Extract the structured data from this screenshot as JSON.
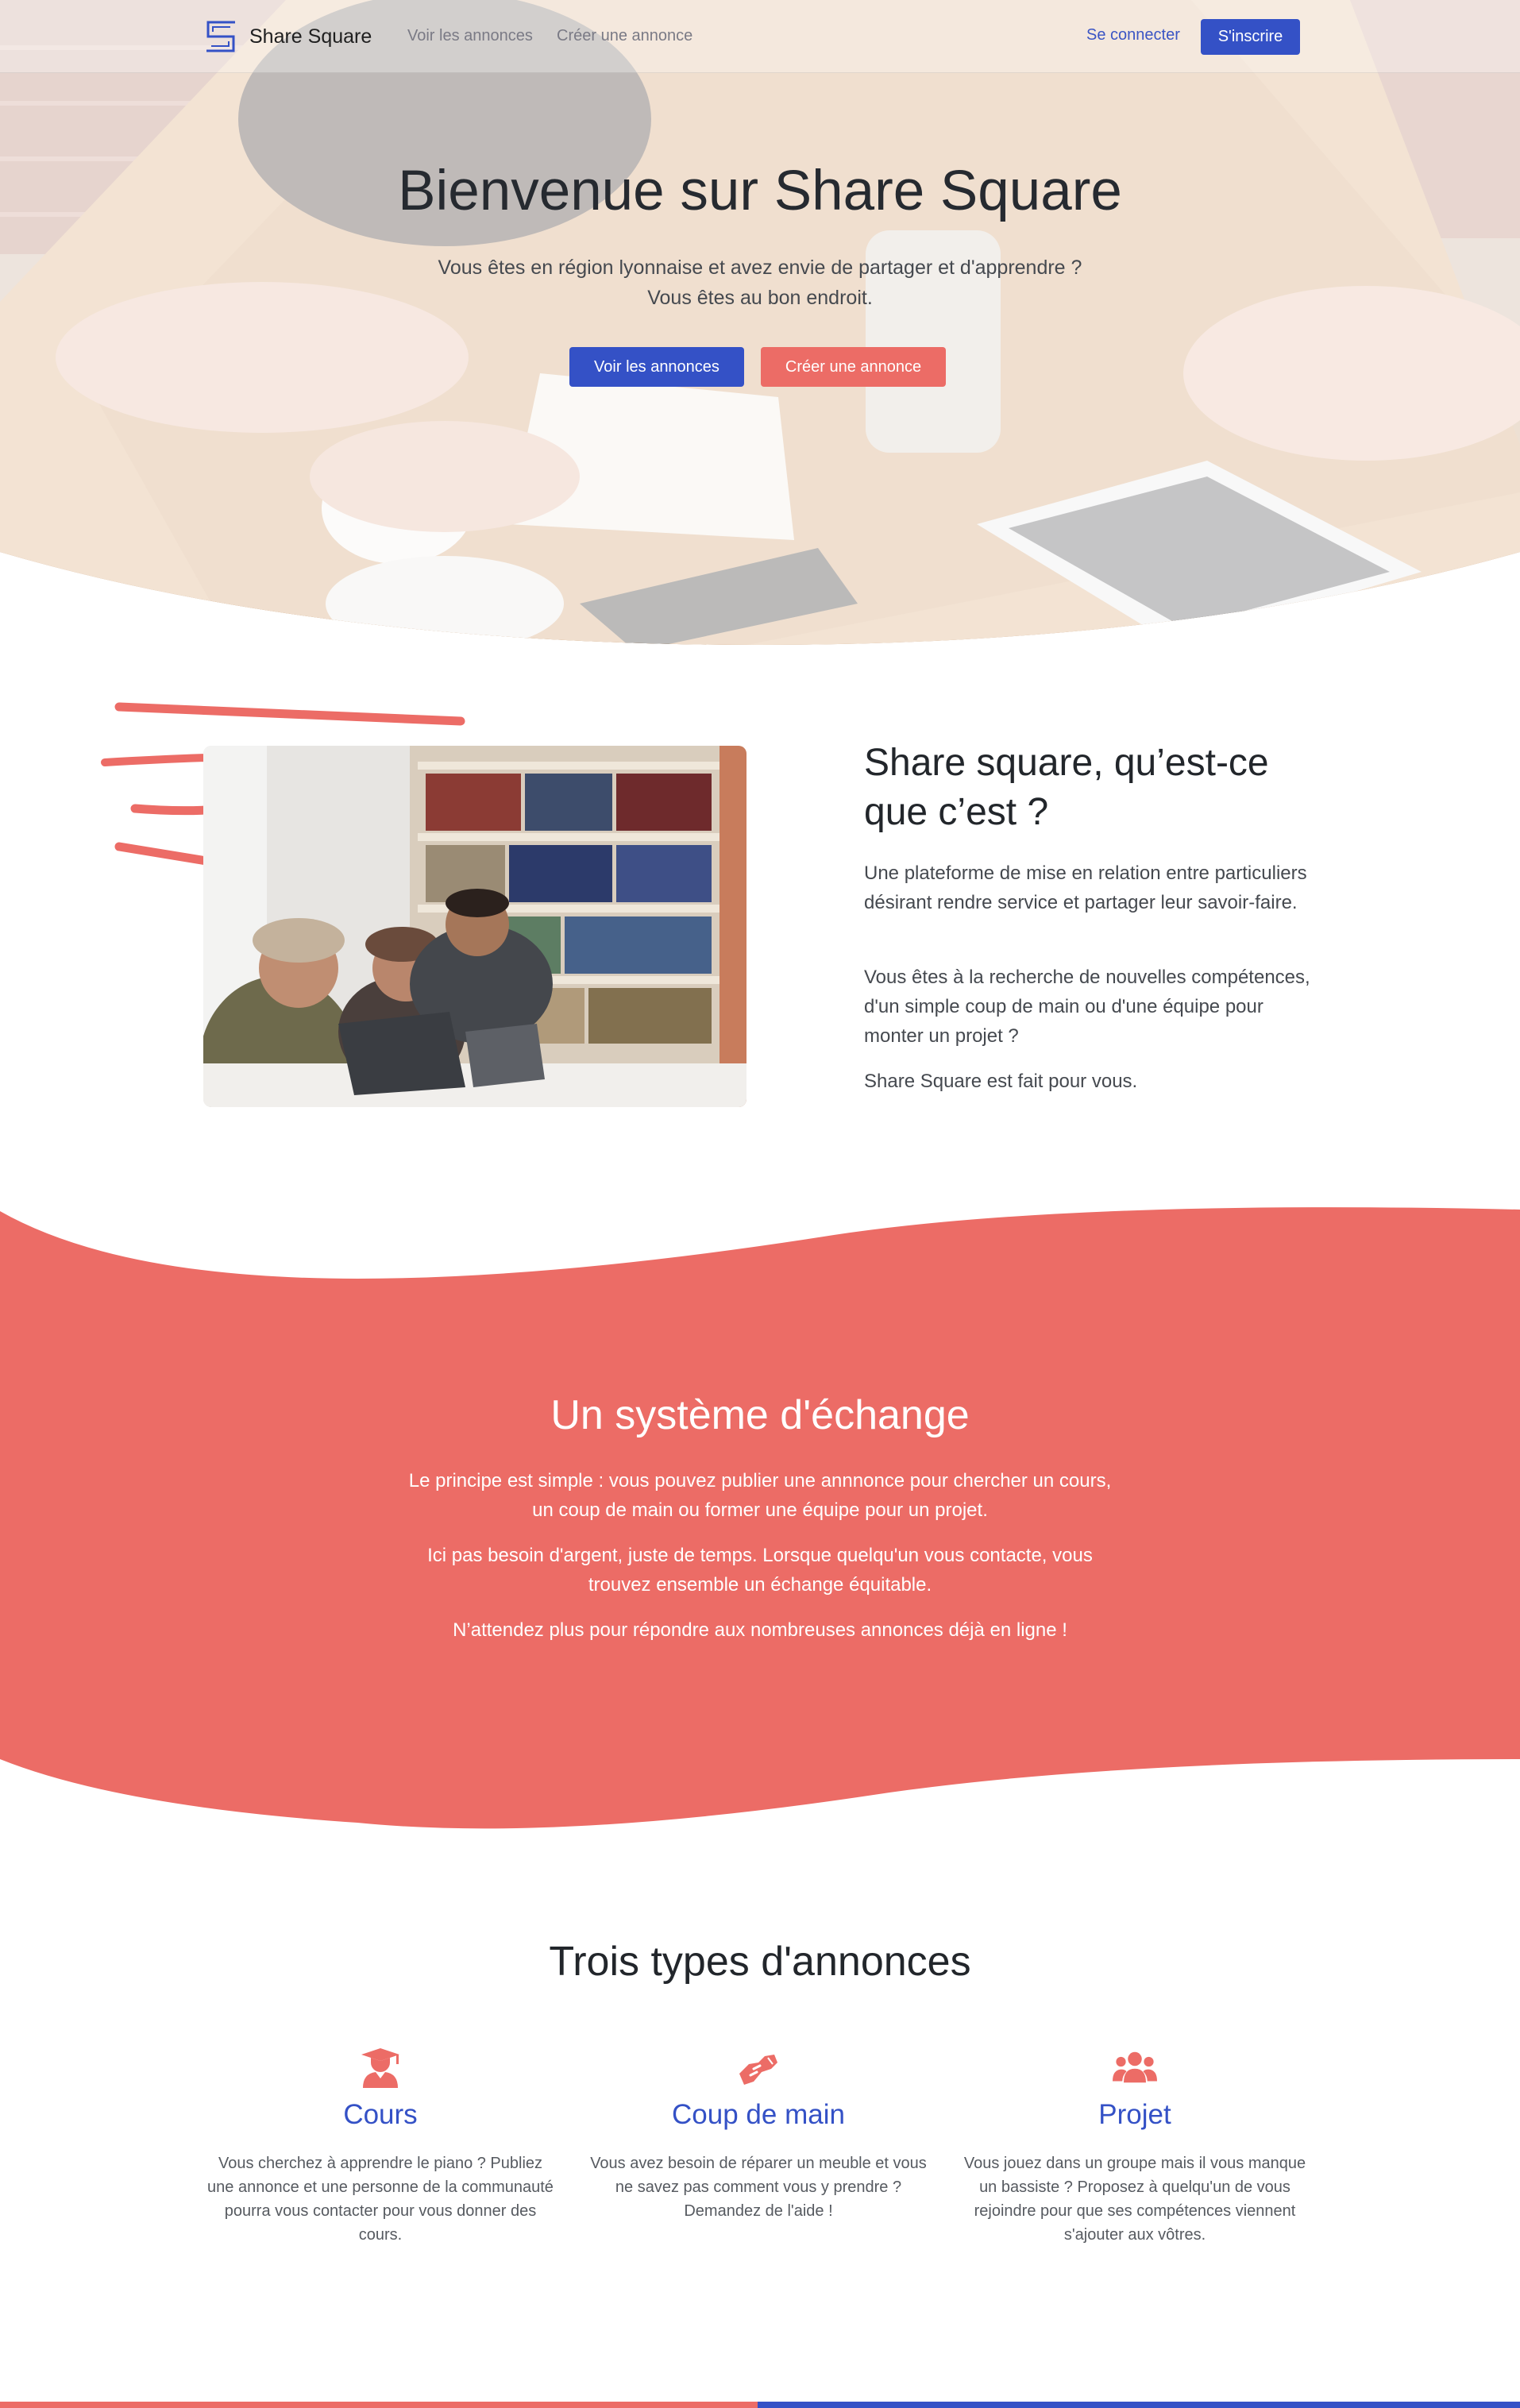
{
  "colors": {
    "primary_blue": "#3451c6",
    "coral": "#ec6c66",
    "text_dark": "#22262b",
    "text_muted": "#45494f"
  },
  "navbar": {
    "brand_name": "Share Square",
    "logo_icon": "share-square-logo-icon",
    "links": [
      "Voir les annonces",
      "Créer une annonce"
    ],
    "login_label": "Se connecter",
    "signup_label": "S'inscrire"
  },
  "hero": {
    "title": "Bienvenue sur Share Square",
    "subtitle_line1": "Vous êtes en région lyonnaise et avez envie de partager et d'apprendre ?",
    "subtitle_line2": "Vous êtes au bon endroit.",
    "btn_primary": "Voir les annonces",
    "btn_secondary": "Créer une annonce"
  },
  "about": {
    "title": "Share square, qu’est-ce que c’est ?",
    "paragraphs": [
      "Une plateforme de mise en relation entre particuliers désirant rendre service et partager leur savoir-faire.",
      "Vous êtes à la recherche de nouvelles compétences, d'un simple coup de main ou d'une équipe pour monter un projet ?",
      "Share Square est fait pour vous."
    ]
  },
  "exchange": {
    "title": "Un système d'échange",
    "paragraphs": [
      "Le principe est simple : vous pouvez publier une annnonce pour chercher un cours, un coup de main ou former une équipe pour un projet.",
      "Ici pas besoin d'argent, juste de temps. Lorsque quelqu'un vous contacte, vous trouvez ensemble un échange équitable.",
      "N’attendez plus pour répondre aux nombreuses annonces déjà en ligne !"
    ]
  },
  "types": {
    "title": "Trois types d'annonces",
    "items": [
      {
        "icon": "graduate-user-icon",
        "name": "Cours",
        "description": "Vous cherchez à apprendre le piano ? Publiez une annonce et une personne de la communauté pourra vous contacter pour vous donner des cours."
      },
      {
        "icon": "handshake-icon",
        "name": "Coup de main",
        "description": "Vous avez besoin de réparer un meuble et vous ne savez pas comment vous y prendre ? Demandez de l'aide !"
      },
      {
        "icon": "users-group-icon",
        "name": "Projet",
        "description": "Vous jouez dans un groupe mais il vous manque un bassiste ? Proposez à quelqu'un de vous rejoindre pour que ses compétences viennent s'ajouter aux vôtres."
      }
    ]
  }
}
